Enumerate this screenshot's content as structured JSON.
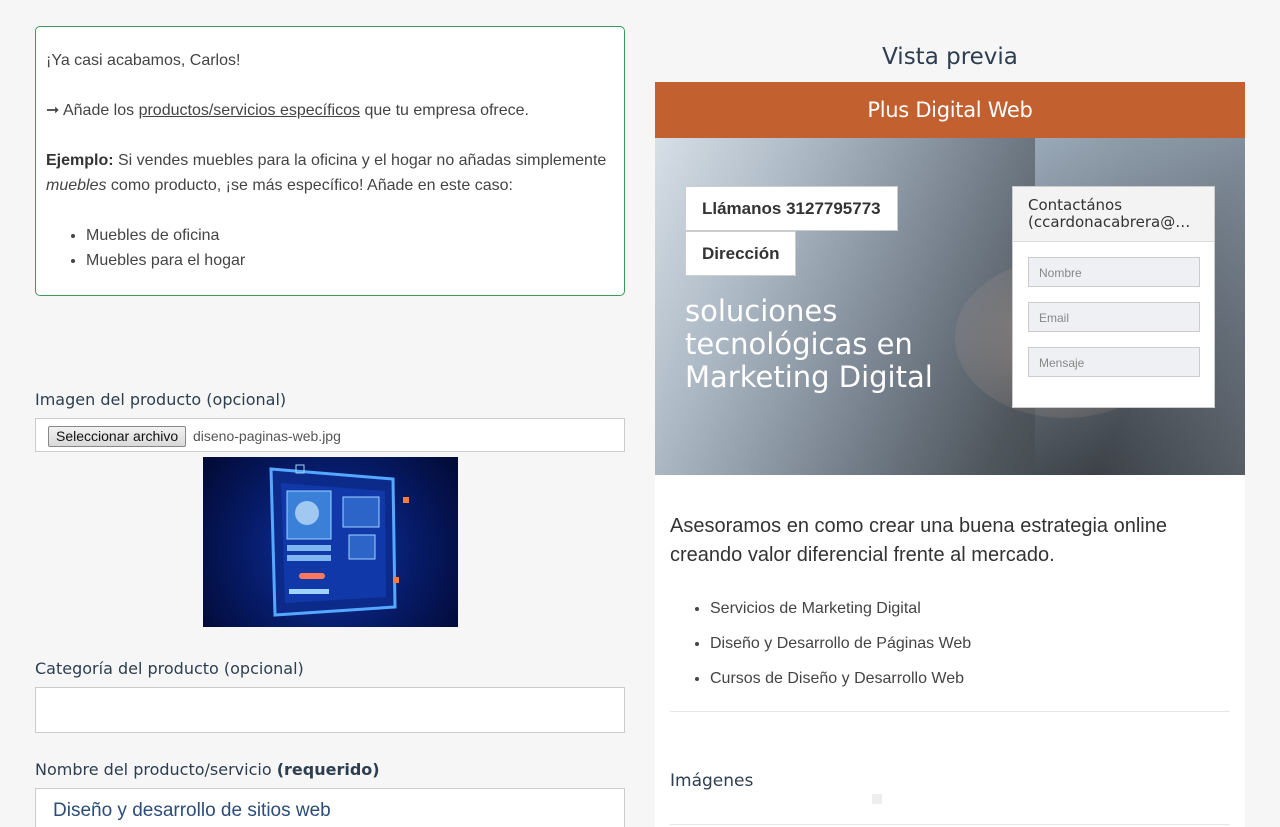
{
  "info": {
    "greeting": "¡Ya casi acabamos, Carlos!",
    "arrow": "➞",
    "instruction_pre": " Añade los ",
    "instruction_link": "productos/servicios específicos",
    "instruction_post": " que tu empresa ofrece.",
    "example_label": "Ejemplo:",
    "example_text_1": " Si vendes muebles para la oficina y el hogar no añadas simplemente ",
    "example_italic": "muebles",
    "example_text_2": " como producto, ¡se más específico! Añade en este caso:",
    "examples": [
      "Muebles de oficina",
      "Muebles para el hogar"
    ]
  },
  "image_field": {
    "label": "Imagen del producto (opcional)",
    "button": "Seleccionar archivo",
    "filename": "diseno-paginas-web.jpg"
  },
  "category_field": {
    "label": "Categoría del producto (opcional)",
    "value": ""
  },
  "name_field": {
    "label_prefix": "Nombre del producto/servicio ",
    "label_required": "(requerido)",
    "value": "Diseño y desarrollo de sitios web"
  },
  "preview": {
    "title": "Vista previa",
    "brand": "Plus Digital Web",
    "call_button": "Llámanos 3127795773",
    "address_button": "Dirección",
    "hero_text": "soluciones tecnológicas en Marketing Digital",
    "contact_title": "Contactános",
    "contact_email": "(ccardonacabrera@gmail.com)",
    "contact_fields": [
      "Nombre",
      "Email",
      "Mensaje"
    ],
    "lead": "Asesoramos en como crear una buena estrategia online creando valor diferencial frente al mercado.",
    "services": [
      "Servicios de Marketing Digital",
      "Diseño y Desarrollo de Páginas Web",
      "Cursos de Diseño y Desarrollo Web"
    ],
    "images_heading": "Imágenes"
  }
}
